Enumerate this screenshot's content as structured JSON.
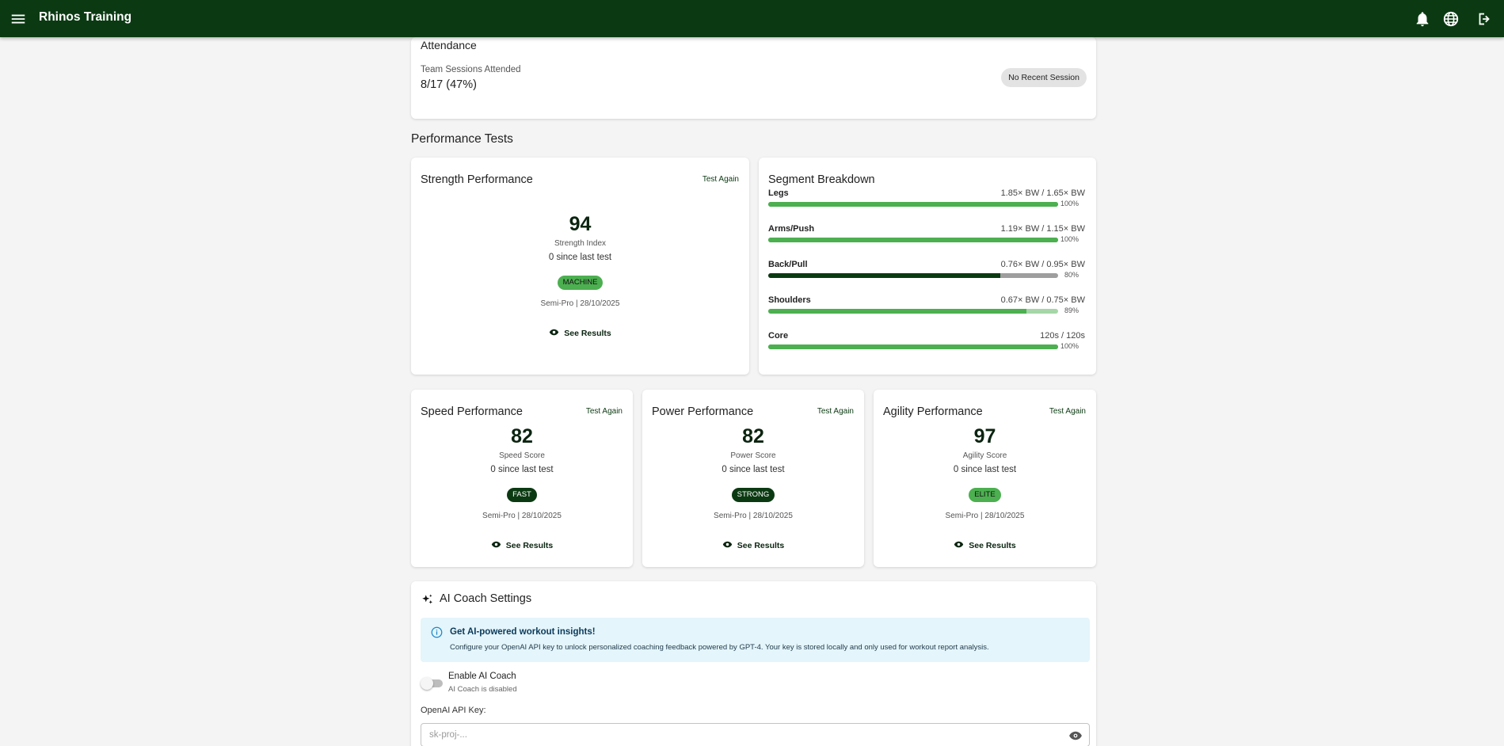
{
  "app": {
    "title": "Rhinos Training",
    "icons": [
      "menu-icon",
      "bell-icon",
      "globe-icon",
      "logout-icon"
    ],
    "colors": {
      "brand": "#0b3a12",
      "accent": "#4caf50",
      "muted_track": "#9e9e9e",
      "light_track": "#a5d6a7",
      "info_bg": "#e4f5fb"
    }
  },
  "attendance": {
    "title": "Attendance",
    "label": "Team Sessions Attended",
    "value": "8/17 (47%)",
    "status_chip": "No Recent Session"
  },
  "performance_tests": {
    "title": "Performance Tests",
    "test_again_label": "Test Again",
    "see_results_label": "See Results",
    "since_text": "0 since last test",
    "strength": {
      "title": "Strength Performance",
      "score": "94",
      "score_label": "Strength Index",
      "badge": "MACHINE",
      "meta": "Semi-Pro | 28/10/2025"
    },
    "speed": {
      "title": "Speed Performance",
      "score": "82",
      "score_label": "Speed Score",
      "badge": "FAST",
      "meta": "Semi-Pro | 28/10/2025"
    },
    "power": {
      "title": "Power Performance",
      "score": "82",
      "score_label": "Power Score",
      "badge": "STRONG",
      "meta": "Semi-Pro | 28/10/2025"
    },
    "agility": {
      "title": "Agility Performance",
      "score": "97",
      "score_label": "Agility Score",
      "badge": "ELITE",
      "meta": "Semi-Pro | 28/10/2025"
    }
  },
  "segment_breakdown": {
    "title": "Segment Breakdown",
    "segments": [
      {
        "name": "Legs",
        "value": "1.85× BW / 1.65× BW",
        "percent_label": "100%",
        "fill": 1.0,
        "fill_color": "#4caf50",
        "track_color": "#4caf50"
      },
      {
        "name": "Arms/Push",
        "value": "1.19× BW / 1.15× BW",
        "percent_label": "100%",
        "fill": 1.0,
        "fill_color": "#4caf50",
        "track_color": "#4caf50"
      },
      {
        "name": "Back/Pull",
        "value": "0.76× BW / 0.95× BW",
        "percent_label": "80%",
        "fill": 0.8,
        "fill_color": "#0b3a12",
        "track_color": "#9e9e9e"
      },
      {
        "name": "Shoulders",
        "value": "0.67× BW / 0.75× BW",
        "percent_label": "89%",
        "fill": 0.89,
        "fill_color": "#4caf50",
        "track_color": "#a5d6a7"
      },
      {
        "name": "Core",
        "value": "120s / 120s",
        "percent_label": "100%",
        "fill": 1.0,
        "fill_color": "#4caf50",
        "track_color": "#4caf50"
      }
    ]
  },
  "ai_coach": {
    "title": "AI Coach Settings",
    "info_title": "Get AI-powered workout insights!",
    "info_text": "Configure your OpenAI API key to unlock personalized coaching feedback powered by GPT-4. Your key is stored locally and only used for workout report analysis.",
    "toggle_label": "Enable AI Coach",
    "toggle_status": "AI Coach is disabled",
    "toggle_enabled": false,
    "api_key_label": "OpenAI API Key:",
    "api_key_placeholder": "sk-proj-...",
    "api_key_value": ""
  }
}
